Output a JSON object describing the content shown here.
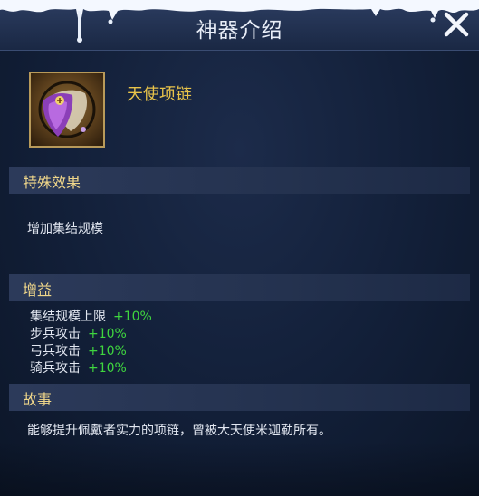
{
  "header": {
    "title": "神器介绍"
  },
  "item": {
    "name": "天使项链"
  },
  "special": {
    "heading": "特殊效果",
    "text": "增加集结规模"
  },
  "bonus": {
    "heading": "增益",
    "rows": [
      {
        "label": "集结规模上限",
        "value": "+10%"
      },
      {
        "label": "步兵攻击",
        "value": "+10%"
      },
      {
        "label": "弓兵攻击",
        "value": "+10%"
      },
      {
        "label": "骑兵攻击",
        "value": "+10%"
      }
    ]
  },
  "story": {
    "heading": "故事",
    "text": "能够提升佩戴者实力的项链，曾被大天使米迦勒所有。"
  },
  "colors": {
    "accent_gold": "#e8c34a",
    "heading_gold": "#f0d78a",
    "bonus_green": "#3fd63f"
  }
}
